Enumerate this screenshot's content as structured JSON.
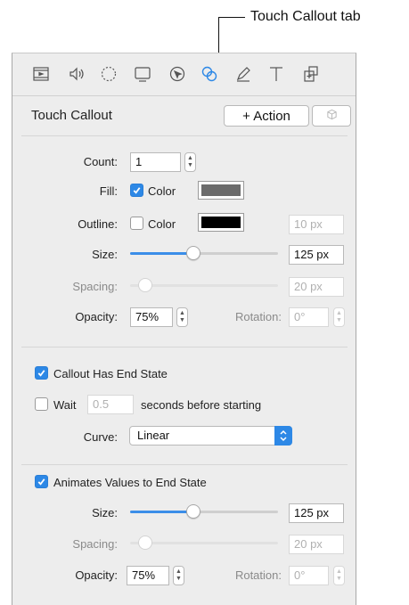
{
  "callout": {
    "label": "Touch Callout tab"
  },
  "toolbar": {
    "active_color": "#2d88e6",
    "icons": [
      {
        "name": "filmstrip-icon",
        "state": "inactive"
      },
      {
        "name": "speaker-icon",
        "state": "inactive"
      },
      {
        "name": "timer-icon",
        "state": "inactive"
      },
      {
        "name": "display-icon",
        "state": "inactive"
      },
      {
        "name": "pointer-icon",
        "state": "inactive"
      },
      {
        "name": "touch-callout-icon",
        "state": "active"
      },
      {
        "name": "pencil-icon",
        "state": "inactive"
      },
      {
        "name": "text-icon",
        "state": "inactive"
      },
      {
        "name": "layers-icon",
        "state": "inactive"
      }
    ]
  },
  "header": {
    "title": "Touch Callout",
    "action_button": "+ Action",
    "cube_icon": "cube-icon"
  },
  "section1": {
    "count": {
      "label": "Count:",
      "value": "1"
    },
    "fill": {
      "label": "Fill:",
      "checked": true,
      "color_label": "Color",
      "swatch": "#6b6b6b"
    },
    "outline": {
      "label": "Outline:",
      "checked": false,
      "color_label": "Color",
      "swatch": "#000000",
      "width": "10 px"
    },
    "size": {
      "label": "Size:",
      "value": "125 px",
      "level_pct": 42
    },
    "spacing": {
      "label": "Spacing:",
      "value": "20 px",
      "level_pct": 6
    },
    "opacity": {
      "label": "Opacity:",
      "value": "75%"
    },
    "rotation": {
      "label": "Rotation:",
      "value": "0°"
    }
  },
  "section2": {
    "end_state": {
      "label": "Callout Has End State",
      "checked": true
    },
    "wait": {
      "label": "Wait",
      "checked": false,
      "value": "0.5",
      "suffix": "seconds before starting"
    },
    "curve": {
      "label": "Curve:",
      "value": "Linear"
    }
  },
  "section3": {
    "animates": {
      "label": "Animates Values to End State",
      "checked": true
    },
    "size": {
      "label": "Size:",
      "value": "125 px",
      "level_pct": 42
    },
    "spacing": {
      "label": "Spacing:",
      "value": "20 px",
      "level_pct": 6
    },
    "opacity": {
      "label": "Opacity:",
      "value": "75%"
    },
    "rotation": {
      "label": "Rotation:",
      "value": "0°"
    }
  }
}
